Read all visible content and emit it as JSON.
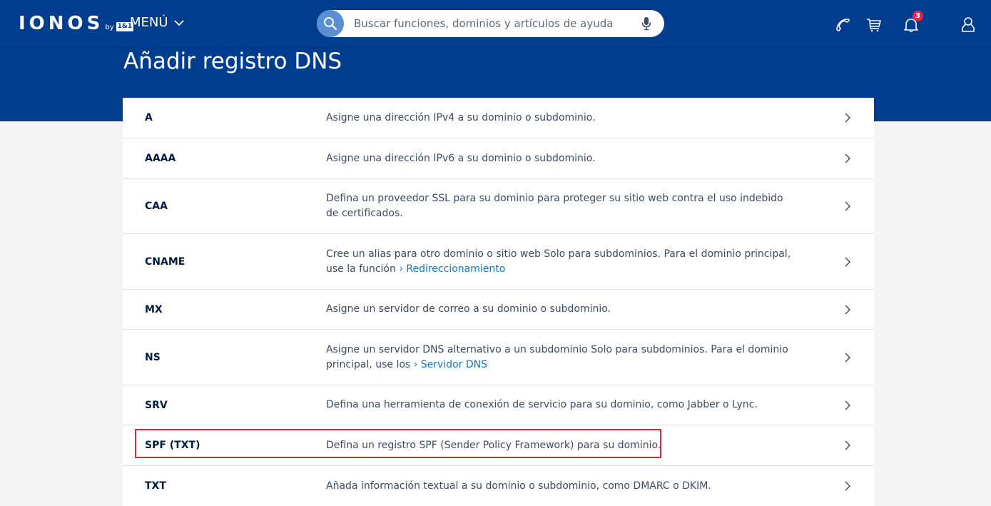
{
  "header": {
    "logo_text": "IONOS",
    "logo_by": "by",
    "logo_partner": "1&1",
    "menu_label": "MENÚ",
    "search_placeholder": "Buscar funciones, dominios y artículos de ayuda",
    "notification_count": "3",
    "icons": [
      "phone-icon",
      "cart-icon",
      "bell-icon",
      "user-icon",
      "search-icon",
      "microphone-icon"
    ]
  },
  "page": {
    "title": "Añadir registro DNS"
  },
  "records": [
    {
      "type": "A",
      "description": "Asigne una dirección IPv4 a su dominio o subdominio."
    },
    {
      "type": "AAAA",
      "description": "Asigne una dirección IPv6 a su dominio o subdominio."
    },
    {
      "type": "CAA",
      "description": "Defina un proveedor SSL para su dominio para proteger su sitio web contra el uso indebido de certificados."
    },
    {
      "type": "CNAME",
      "description": "Cree un alias para otro dominio o sitio web Solo para subdominios. Para el dominio principal, use la función",
      "link_text": "Redireccionamiento"
    },
    {
      "type": "MX",
      "description": "Asigne un servidor de correo a su dominio o subdominio."
    },
    {
      "type": "NS",
      "description": "Asigne un servidor DNS alternativo a un subdominio Solo para subdominios. Para el dominio principal, use los",
      "link_text": "Servidor DNS"
    },
    {
      "type": "SRV",
      "description": "Defina una herramienta de conexión de servicio para su dominio, como Jabber o Lync."
    },
    {
      "type": "SPF (TXT)",
      "description": "Defina un registro SPF (Sender Policy Framework) para su dominio."
    },
    {
      "type": "TXT",
      "description": "Añada información textual a su dominio o subdominio, como DMARC o DKIM."
    }
  ],
  "colors": {
    "brand_blue": "#003d8f",
    "link": "#1474c4",
    "highlight": "#e2233a",
    "badge": "#e3244b"
  }
}
